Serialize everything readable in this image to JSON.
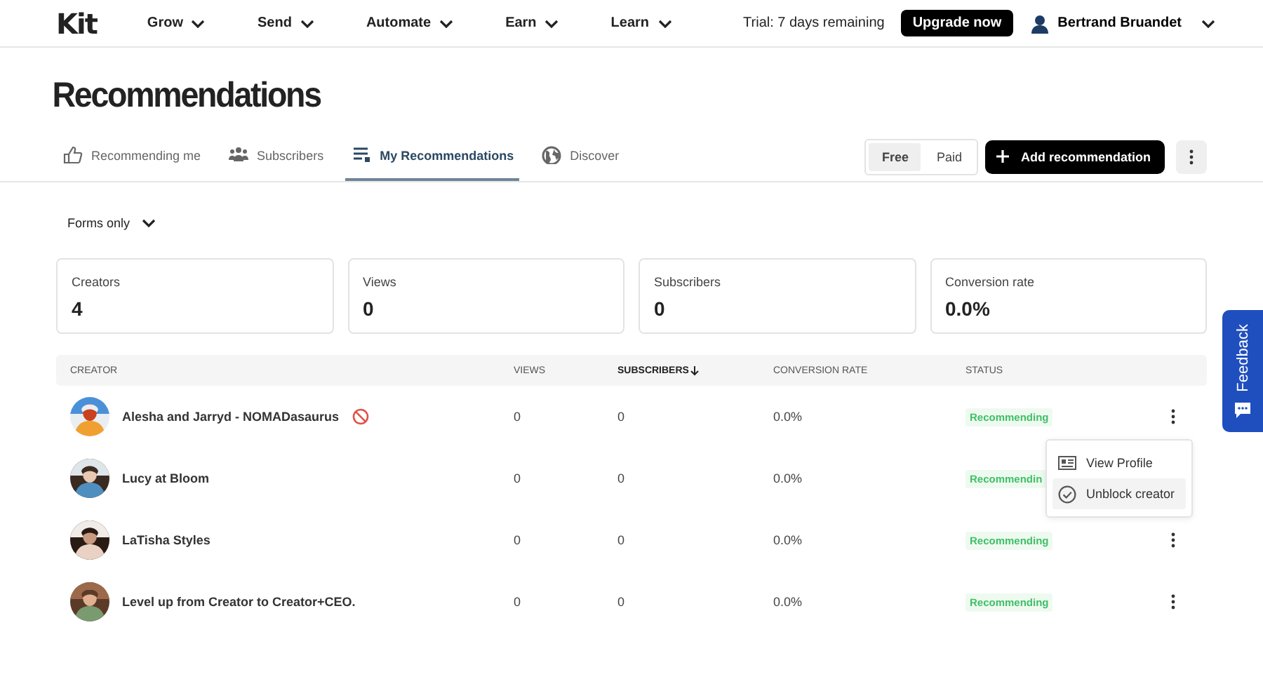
{
  "header": {
    "logo": "Kit",
    "nav": [
      {
        "label": "Grow"
      },
      {
        "label": "Send"
      },
      {
        "label": "Automate"
      },
      {
        "label": "Earn"
      },
      {
        "label": "Learn"
      }
    ],
    "trial": "Trial: 7 days remaining",
    "upgrade": "Upgrade now",
    "user": "Bertrand Bruandet"
  },
  "page_title": "Recommendations",
  "tabs": [
    {
      "label": "Recommending me",
      "selected": false
    },
    {
      "label": "Subscribers",
      "selected": false
    },
    {
      "label": "My Recommendations",
      "selected": true
    },
    {
      "label": "Discover",
      "selected": false
    }
  ],
  "plan_toggle": [
    {
      "label": "Free",
      "selected": true
    },
    {
      "label": "Paid",
      "selected": false
    }
  ],
  "add_button": "Add recommendation",
  "filter": "Forms only",
  "stats": [
    {
      "label": "Creators",
      "value": "4"
    },
    {
      "label": "Views",
      "value": "0"
    },
    {
      "label": "Subscribers",
      "value": "0"
    },
    {
      "label": "Conversion rate",
      "value": "0.0%"
    }
  ],
  "table": {
    "columns": [
      {
        "label": "CREATOR",
        "sorted": false
      },
      {
        "label": "VIEWS",
        "sorted": false
      },
      {
        "label": "SUBSCRIBERS",
        "sorted": true
      },
      {
        "label": "CONVERSION RATE",
        "sorted": false
      },
      {
        "label": "STATUS",
        "sorted": false
      }
    ],
    "rows": [
      {
        "creator": "Alesha and Jarryd - NOMADasaurus",
        "blocked": true,
        "views": "0",
        "subscribers": "0",
        "conversion_rate": "0.0%",
        "status": "Recommending",
        "more_button": true
      },
      {
        "creator": "Lucy at Bloom",
        "blocked": false,
        "views": "0",
        "subscribers": "0",
        "conversion_rate": "0.0%",
        "status": "Recommendin",
        "more_button": false
      },
      {
        "creator": "LaTisha Styles",
        "blocked": false,
        "views": "0",
        "subscribers": "0",
        "conversion_rate": "0.0%",
        "status": "Recommending",
        "more_button": true
      },
      {
        "creator": "Level up from Creator to Creator+CEO.",
        "blocked": false,
        "views": "0",
        "subscribers": "0",
        "conversion_rate": "0.0%",
        "status": "Recommending",
        "more_button": true
      }
    ]
  },
  "row_menu": {
    "items": [
      {
        "label": "View Profile",
        "selected": false
      },
      {
        "label": "Unblock creator",
        "selected": true
      }
    ]
  },
  "feedback": "Feedback"
}
